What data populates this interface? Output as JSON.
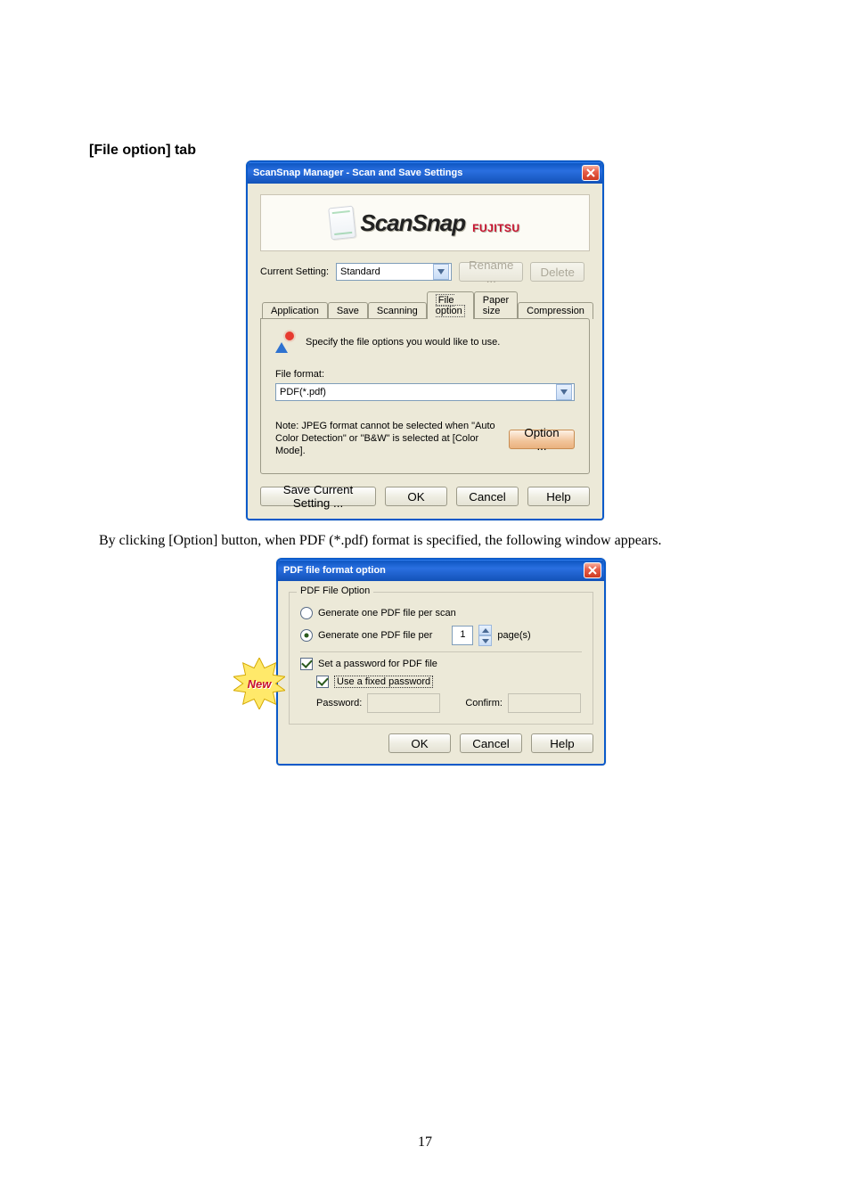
{
  "page": {
    "heading": "[File option] tab",
    "caption": "By clicking [Option] button, when PDF (*.pdf) format is specified, the following window appears.",
    "number": "17"
  },
  "manager": {
    "title": "ScanSnap Manager - Scan and Save Settings",
    "logo": {
      "brand": "ScanSnap",
      "vendor": "FUJITSU"
    },
    "currentSetting": {
      "label": "Current Setting:",
      "value": "Standard"
    },
    "buttons": {
      "rename": "Rename ...",
      "delete": "Delete"
    },
    "tabs": [
      "Application",
      "Save",
      "Scanning",
      "File option",
      "Paper size",
      "Compression"
    ],
    "activeTab": "File option",
    "tabContent": {
      "desc": "Specify the file options you would like to use.",
      "fileFormatLabel": "File format:",
      "fileFormatValue": "PDF(*.pdf)",
      "note": "Note: JPEG format cannot be selected when \"Auto Color Detection\" or \"B&W\" is selected at [Color Mode].",
      "optionBtn": "Option ..."
    },
    "footer": {
      "saveCurrent": "Save Current Setting ...",
      "ok": "OK",
      "cancel": "Cancel",
      "help": "Help"
    }
  },
  "pdf": {
    "title": "PDF file format option",
    "fieldsetLegend": "PDF File Option",
    "radioPerScan": "Generate one PDF file per scan",
    "radioPerPages": {
      "label": "Generate one PDF file per",
      "value": "1",
      "suffix": "page(s)"
    },
    "chkSetPwd": "Set a password for PDF file",
    "chkFixedPwd": "Use a fixed password",
    "pwdLabel": "Password:",
    "confirmLabel": "Confirm:",
    "ok": "OK",
    "cancel": "Cancel",
    "help": "Help",
    "badge": "New"
  }
}
